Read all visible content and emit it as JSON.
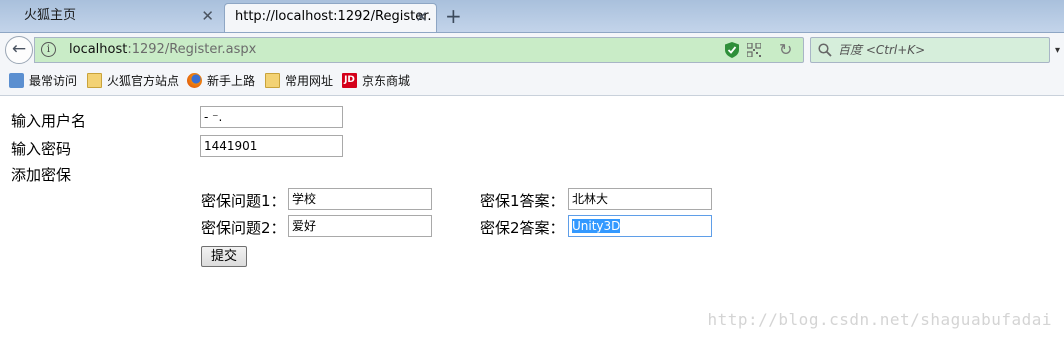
{
  "browser": {
    "tabs": [
      {
        "title": "火狐主页",
        "active": false
      },
      {
        "title": "http://localhost:1292/Register.",
        "active": true
      }
    ],
    "tab_close_glyph": "✕",
    "new_tab_glyph": "+",
    "back_glyph": "←",
    "url": {
      "host": "localhost",
      "rest": ":1292/Register.aspx"
    },
    "info_glyph": "i",
    "reload_glyph": "↻",
    "search_placeholder": "百度 <Ctrl+K>",
    "menu_glyph": "▾"
  },
  "bookmarks": [
    {
      "label": "最常访问",
      "icon": "recent-icon"
    },
    {
      "label": "火狐官方站点",
      "icon": "folder-icon"
    },
    {
      "label": "新手上路",
      "icon": "firefox-icon"
    },
    {
      "label": "常用网址",
      "icon": "folder-icon"
    },
    {
      "label": "京东商城",
      "icon": "jd-icon"
    }
  ],
  "jd_icon_text": "JD",
  "form": {
    "username_label": "输入用户名",
    "username_value": "-  ⁻.",
    "password_label": "输入密码",
    "password_value": "1441901",
    "security_label": "添加密保",
    "question1_label": "密保问题1：",
    "question1_value": "学校",
    "answer1_label": "密保1答案：",
    "answer1_value": "北林大",
    "question2_label": "密保问题2：",
    "question2_value": "爱好",
    "answer2_label": "密保2答案：",
    "answer2_value": "Unity3D",
    "submit_label": "提交"
  },
  "watermark": "http://blog.csdn.net/shaguabufadai",
  "colors": {
    "url_bar_bg": "#c9ecc7",
    "selection": "#3399ff",
    "jd_red": "#d4001a"
  }
}
